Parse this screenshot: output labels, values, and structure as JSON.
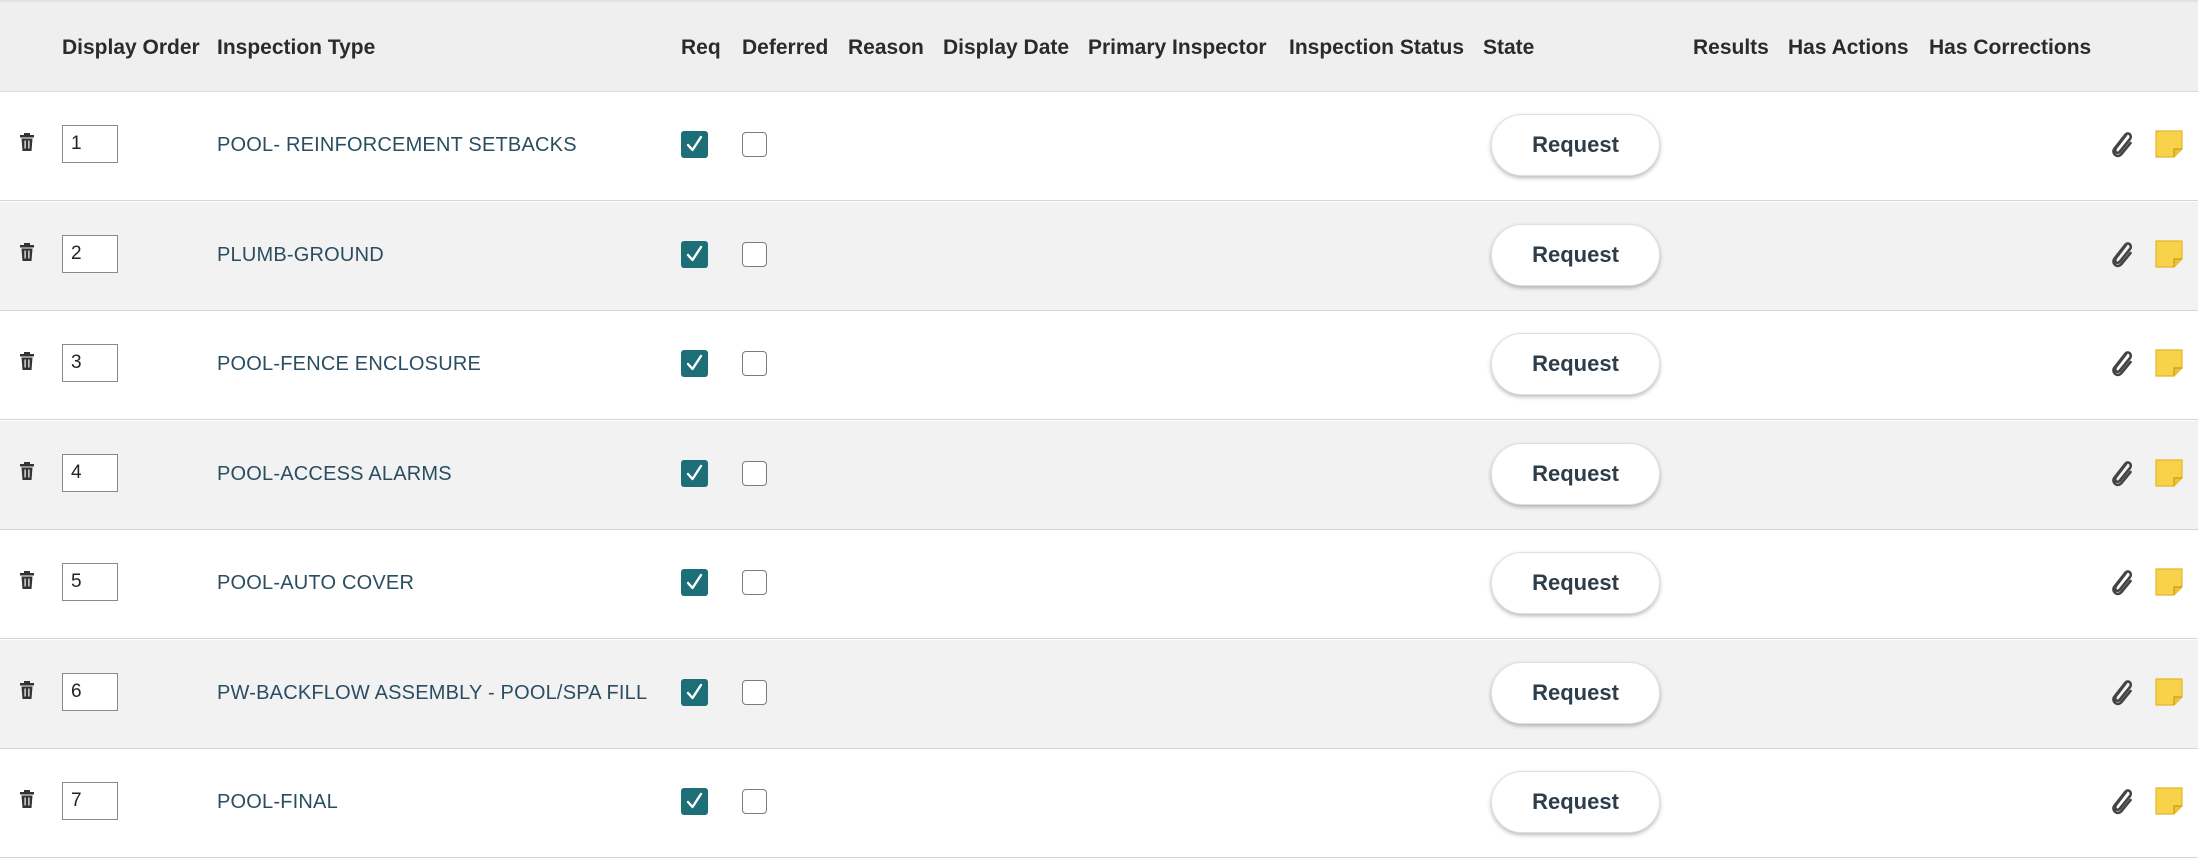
{
  "columns": {
    "display_order": "Display Order",
    "inspection_type": "Inspection Type",
    "req": "Req",
    "deferred": "Deferred",
    "reason": "Reason",
    "display_date": "Display Date",
    "primary_inspector": "Primary Inspector",
    "inspection_status": "Inspection Status",
    "state": "State",
    "results": "Results",
    "has_actions": "Has Actions",
    "has_corrections": "Has Corrections"
  },
  "rows": [
    {
      "order": "1",
      "type": "POOL- REINFORCEMENT SETBACKS",
      "req": true,
      "deferred": false,
      "state_button": "Request"
    },
    {
      "order": "2",
      "type": "PLUMB-GROUND",
      "req": true,
      "deferred": false,
      "state_button": "Request"
    },
    {
      "order": "3",
      "type": "POOL-FENCE ENCLOSURE",
      "req": true,
      "deferred": false,
      "state_button": "Request"
    },
    {
      "order": "4",
      "type": "POOL-ACCESS ALARMS",
      "req": true,
      "deferred": false,
      "state_button": "Request"
    },
    {
      "order": "5",
      "type": "POOL-AUTO COVER",
      "req": true,
      "deferred": false,
      "state_button": "Request"
    },
    {
      "order": "6",
      "type": "PW-BACKFLOW ASSEMBLY - POOL/SPA FILL",
      "req": true,
      "deferred": false,
      "state_button": "Request"
    },
    {
      "order": "7",
      "type": "POOL-FINAL",
      "req": true,
      "deferred": false,
      "state_button": "Request"
    }
  ],
  "icons": {
    "delete": "trash-icon",
    "attachment": "paperclip-icon",
    "note": "sticky-note-icon"
  },
  "colors": {
    "checked": "#1d6f77",
    "type_text": "#2a4d62",
    "note": "#f7d24a",
    "header_bg": "#efefef",
    "alt_row_bg": "#f2f2f2"
  }
}
